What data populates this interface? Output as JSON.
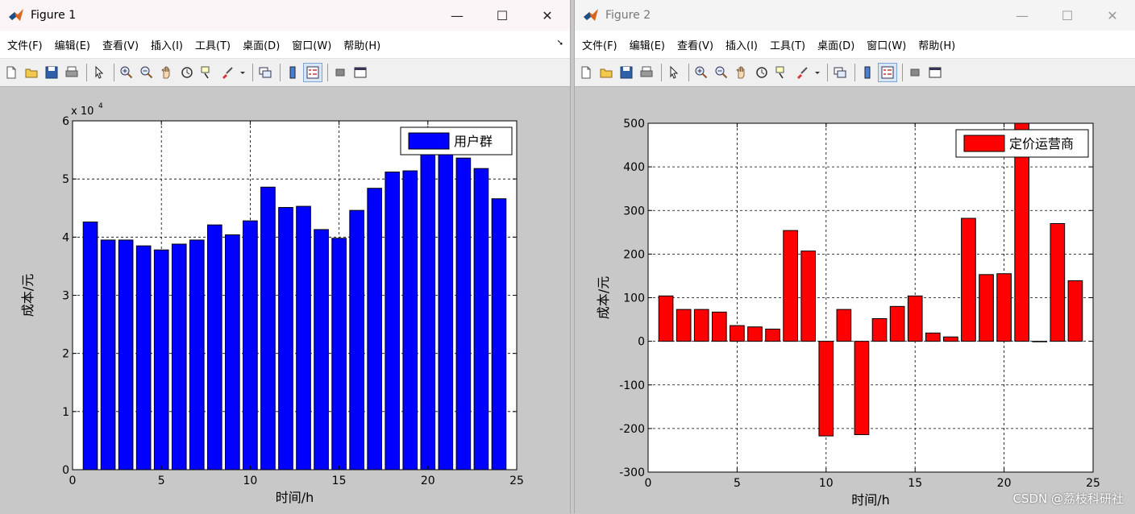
{
  "colors": {
    "figure_bg": "#c8c8c8",
    "axes_bg": "#ffffff",
    "series1": "#0000ff",
    "series2": "#ff0000"
  },
  "windows": [
    {
      "title": "Figure 1",
      "menu": [
        "文件(F)",
        "编辑(E)",
        "查看(V)",
        "插入(I)",
        "工具(T)",
        "桌面(D)",
        "窗口(W)",
        "帮助(H)"
      ],
      "controls": {
        "minimize": "—",
        "maximize": "☐",
        "close": "✕"
      }
    },
    {
      "title": "Figure 2",
      "menu": [
        "文件(F)",
        "编辑(E)",
        "查看(V)",
        "插入(I)",
        "工具(T)",
        "桌面(D)",
        "窗口(W)",
        "帮助(H)"
      ],
      "controls": {
        "minimize": "—",
        "maximize": "☐",
        "close": "✕"
      }
    }
  ],
  "toolbar_icons": [
    "new-figure-icon",
    "open-file-icon",
    "save-icon",
    "print-icon",
    "arrow-select-icon",
    "zoom-in-icon",
    "zoom-out-icon",
    "pan-hand-icon",
    "rotate-3d-icon",
    "data-cursor-icon",
    "brush-icon",
    "brush-dropdown-icon",
    "link-plot-icon",
    "colorbar-icon",
    "legend-icon",
    "hide-plot-tools-icon",
    "show-plot-tools-icon"
  ],
  "chart_data": [
    {
      "type": "bar",
      "xlabel": "时间/h",
      "ylabel": "成本/元",
      "y_multiplier_label": "x 10",
      "y_multiplier_exp": "4",
      "xlim": [
        0,
        25
      ],
      "ylim": [
        0,
        60000
      ],
      "xticks": [
        0,
        5,
        10,
        15,
        20,
        25
      ],
      "xtick_labels": [
        "0",
        "5",
        "10",
        "15",
        "20",
        "25"
      ],
      "yticks": [
        0,
        10000,
        20000,
        30000,
        40000,
        50000,
        60000
      ],
      "ytick_labels": [
        "0",
        "1",
        "2",
        "3",
        "4",
        "5",
        "6"
      ],
      "grid": true,
      "legend_position": "top-right",
      "series": [
        {
          "name": "用户群",
          "color": "#0000ff",
          "x": [
            1,
            2,
            3,
            4,
            5,
            6,
            7,
            8,
            9,
            10,
            11,
            12,
            13,
            14,
            15,
            16,
            17,
            18,
            19,
            20,
            21,
            22,
            23,
            24
          ],
          "values": [
            42600,
            39500,
            39500,
            38500,
            37800,
            38800,
            39500,
            42100,
            40400,
            42800,
            48600,
            45100,
            45300,
            41300,
            39800,
            44600,
            48400,
            51200,
            51400,
            55000,
            55000,
            53600,
            51800,
            46600
          ]
        }
      ]
    },
    {
      "type": "bar",
      "xlabel": "时间/h",
      "ylabel": "成本/元",
      "xlim": [
        0,
        25
      ],
      "ylim": [
        -300,
        500
      ],
      "xticks": [
        0,
        5,
        10,
        15,
        20,
        25
      ],
      "xtick_labels": [
        "0",
        "5",
        "10",
        "15",
        "20",
        "25"
      ],
      "yticks": [
        -300,
        -200,
        -100,
        0,
        100,
        200,
        300,
        400,
        500
      ],
      "ytick_labels": [
        "-300",
        "-200",
        "-100",
        "0",
        "100",
        "200",
        "300",
        "400",
        "500"
      ],
      "grid": true,
      "legend_position": "top-right",
      "series": [
        {
          "name": "定价运营商",
          "color": "#ff0000",
          "x": [
            1,
            2,
            3,
            4,
            5,
            6,
            7,
            8,
            9,
            10,
            11,
            12,
            13,
            14,
            15,
            16,
            17,
            18,
            19,
            20,
            21,
            22,
            23,
            24
          ],
          "values": [
            104,
            73,
            73,
            67,
            36,
            33,
            28,
            254,
            207,
            -217,
            73,
            -214,
            52,
            80,
            104,
            19,
            10,
            282,
            153,
            155,
            500,
            0,
            270,
            139
          ]
        }
      ]
    }
  ],
  "watermark": "CSDN @荔枝科研社"
}
